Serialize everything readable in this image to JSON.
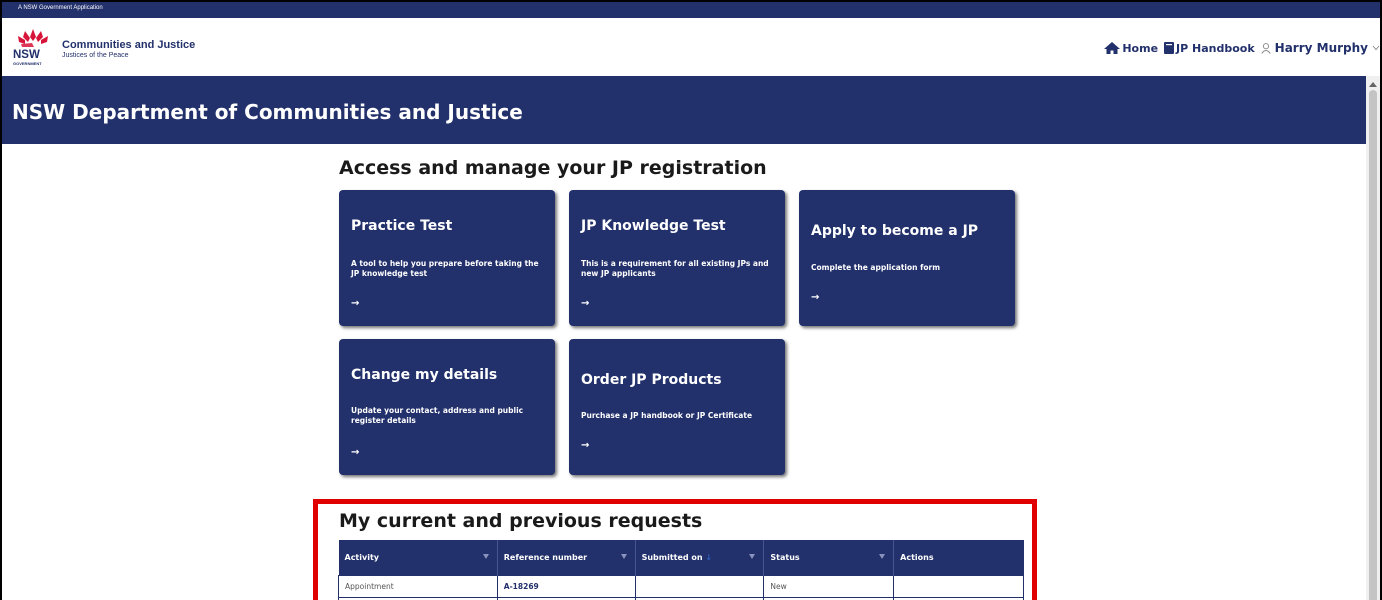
{
  "gov_strip": {
    "text": "A NSW Government Application"
  },
  "header": {
    "logo_text": "NSW",
    "logo_subtext": "GOVERNMENT",
    "brand_title": "Communities and Justice",
    "brand_subtitle": "Justices of the Peace",
    "nav": {
      "home": "Home",
      "handbook": "JP Handbook",
      "user_name": "Harry Murphy"
    }
  },
  "banner": {
    "title": "NSW Department of Communities and Justice"
  },
  "main": {
    "section_title": "Access and manage your JP registration",
    "tiles": [
      {
        "title": "Practice Test",
        "desc": "A tool to help you prepare before taking the JP knowledge test",
        "arrow": "→"
      },
      {
        "title": "JP Knowledge Test",
        "desc": "This is a requirement for all existing JPs and new JP applicants",
        "arrow": "→"
      },
      {
        "title": "Apply to become a JP",
        "desc": "Complete the application form",
        "arrow": "→"
      },
      {
        "title": "Change my details",
        "desc": "Update your contact, address and public register details",
        "arrow": "→"
      },
      {
        "title": "Order JP Products",
        "desc": "Purchase a JP handbook or JP Certificate",
        "arrow": "→"
      }
    ]
  },
  "requests": {
    "title": "My current and previous requests",
    "columns": [
      "Activity",
      "Reference number",
      "Submitted on",
      "Status",
      "Actions"
    ],
    "sort_marker": "↓",
    "rows": [
      {
        "activity": "Appointment",
        "reference": "A-18269",
        "submitted": "",
        "status": "New",
        "actions": ""
      }
    ]
  },
  "colors": {
    "brand_navy": "#22306b",
    "highlight_red": "#e00000",
    "nsw_red": "#d7153a"
  }
}
